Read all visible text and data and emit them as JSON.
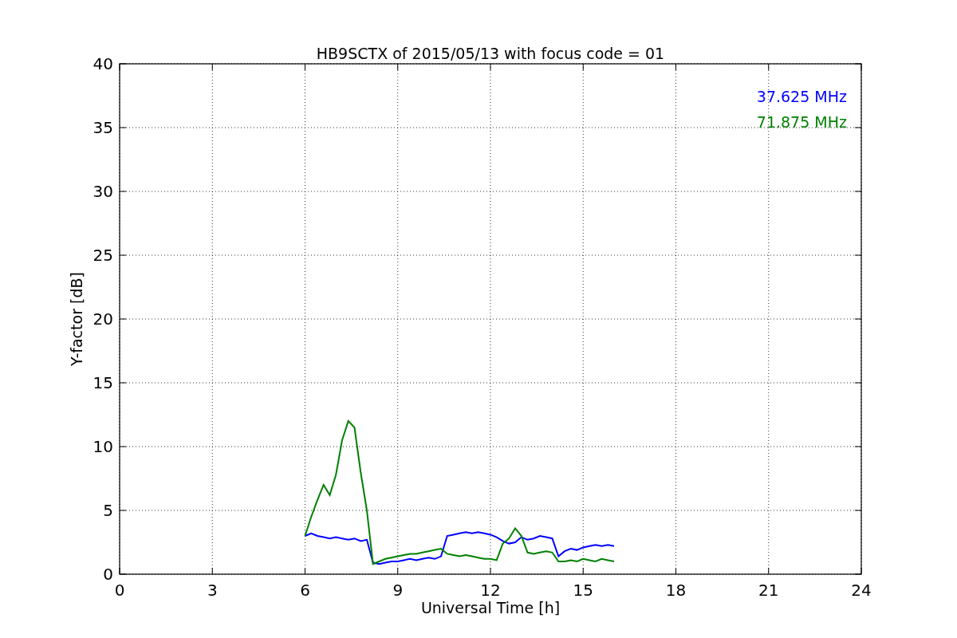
{
  "figure": {
    "chart_data": {
      "type": "line",
      "title": "HB9SCTX of 2015/05/13 with focus code = 01",
      "xlabel": "Universal Time [h]",
      "ylabel": "Y-factor [dB]",
      "grid": true,
      "xlim": [
        0,
        24
      ],
      "ylim": [
        0,
        40
      ],
      "xticks": [
        0,
        3,
        6,
        9,
        12,
        15,
        18,
        21,
        24
      ],
      "yticks": [
        0,
        5,
        10,
        15,
        20,
        25,
        30,
        35,
        40
      ],
      "x": [
        6.0,
        6.2,
        6.4,
        6.6,
        6.8,
        7.0,
        7.2,
        7.4,
        7.6,
        7.8,
        8.0,
        8.2,
        8.4,
        8.6,
        8.8,
        9.0,
        9.2,
        9.4,
        9.6,
        9.8,
        10.0,
        10.2,
        10.4,
        10.6,
        10.8,
        11.0,
        11.2,
        11.4,
        11.6,
        11.8,
        12.0,
        12.2,
        12.4,
        12.6,
        12.8,
        13.0,
        13.2,
        13.4,
        13.6,
        13.8,
        14.0,
        14.2,
        14.4,
        14.6,
        14.8,
        15.0,
        15.2,
        15.4,
        15.6,
        15.8,
        16.0
      ],
      "series": [
        {
          "name": "37.625 MHz",
          "color": "#0000ff",
          "values": [
            3.0,
            3.2,
            3.0,
            2.9,
            2.8,
            2.9,
            2.8,
            2.7,
            2.8,
            2.6,
            2.7,
            0.9,
            0.8,
            0.9,
            1.0,
            1.0,
            1.1,
            1.2,
            1.1,
            1.2,
            1.3,
            1.2,
            1.4,
            3.0,
            3.1,
            3.2,
            3.3,
            3.2,
            3.3,
            3.2,
            3.1,
            2.9,
            2.6,
            2.4,
            2.5,
            2.9,
            2.7,
            2.8,
            3.0,
            2.9,
            2.8,
            1.4,
            1.8,
            2.0,
            1.9,
            2.1,
            2.2,
            2.3,
            2.2,
            2.3,
            2.2
          ]
        },
        {
          "name": "71.875 MHz",
          "color": "#008000",
          "values": [
            3.0,
            4.5,
            5.8,
            7.0,
            6.2,
            7.8,
            10.5,
            12.0,
            11.5,
            8.0,
            5.0,
            0.8,
            1.0,
            1.2,
            1.3,
            1.4,
            1.5,
            1.6,
            1.6,
            1.7,
            1.8,
            1.9,
            2.0,
            1.6,
            1.5,
            1.4,
            1.5,
            1.4,
            1.3,
            1.2,
            1.2,
            1.1,
            2.4,
            2.8,
            3.6,
            3.0,
            1.7,
            1.6,
            1.7,
            1.8,
            1.7,
            1.0,
            1.0,
            1.1,
            1.0,
            1.2,
            1.1,
            1.0,
            1.2,
            1.1,
            1.0
          ]
        }
      ]
    }
  }
}
